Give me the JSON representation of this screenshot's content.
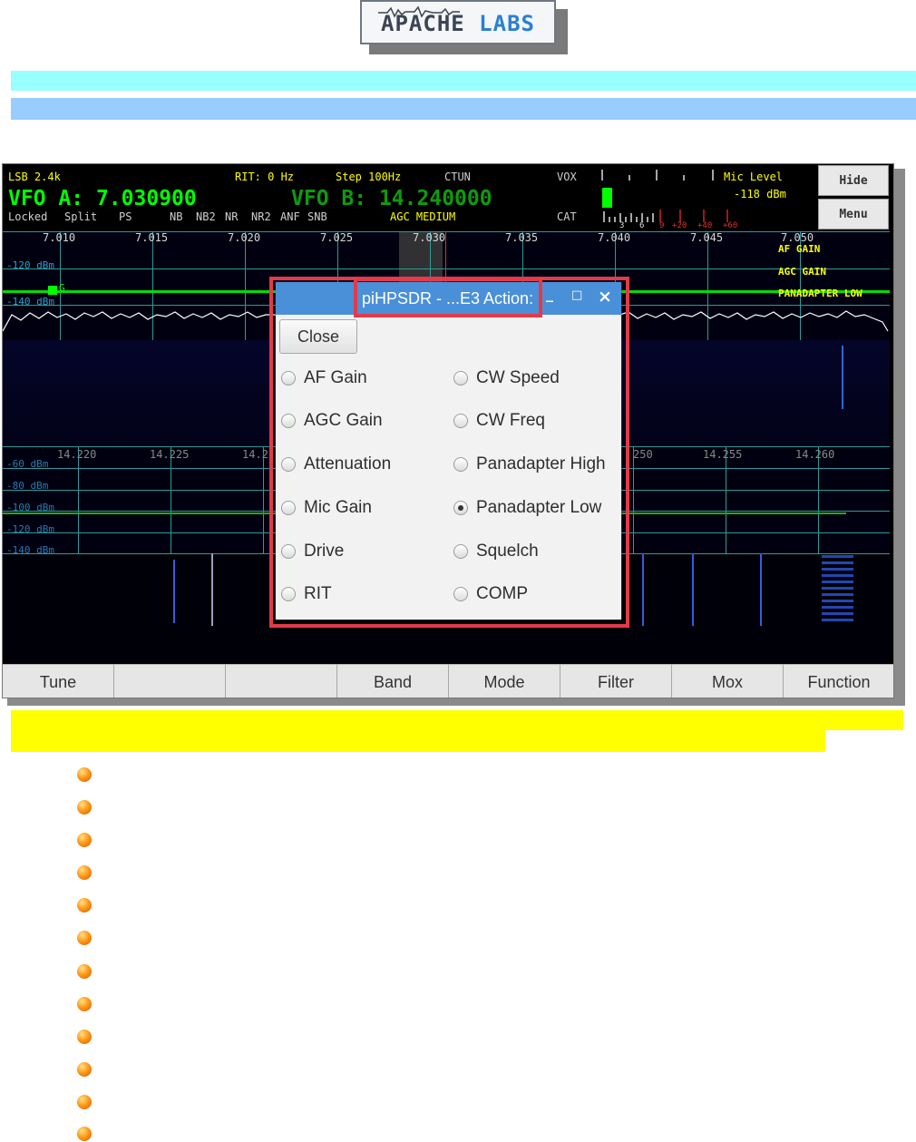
{
  "logo": {
    "text_a": "APACHE",
    "text_b": "LABS"
  },
  "header": {
    "mode": "LSB 2.4k",
    "rit": "RIT: 0 Hz",
    "step": "Step 100Hz",
    "ctun": "CTUN",
    "vox": "VOX",
    "cat": "CAT",
    "mic_level_label": "Mic Level",
    "mic_level_value": "-118 dBm",
    "vfo_a_label": "VFO A:",
    "vfo_a_freq": "7.030900",
    "vfo_b_label": "VFO B:",
    "vfo_b_freq": "14.240000",
    "status_locked": "Locked",
    "status_split": "Split",
    "status_ps": "PS",
    "status_nb": "NB",
    "status_nb2": "NB2",
    "status_nr": "NR",
    "status_nr2": "NR2",
    "status_anf": "ANF",
    "status_snb": "SNB",
    "agc": "AGC MEDIUM",
    "meter_scale": [
      "3",
      "6",
      "9",
      "+20",
      "+40",
      "+60"
    ],
    "hide_label": "Hide",
    "menu_label": "Menu"
  },
  "panadapter_a": {
    "freq_labels": [
      "7.010",
      "7.015",
      "7.020",
      "7.025",
      "7.030",
      "7.035",
      "7.040",
      "7.045",
      "7.050"
    ],
    "db_labels": [
      "-120 dBm",
      "-140 dBm"
    ],
    "marker": "G",
    "overlay": [
      "AF GAIN",
      "AGC GAIN",
      "PANADAPTER LOW"
    ]
  },
  "panadapter_b": {
    "freq_labels": [
      "14.220",
      "14.225",
      "14.2",
      "250",
      "14.255",
      "14.260"
    ],
    "db_labels": [
      "-60 dBm",
      "-80 dBm",
      "-100 dBm",
      "-120 dBm",
      "-140 dBm"
    ]
  },
  "bottom_bar": [
    "Tune",
    "",
    "",
    "Band",
    "Mode",
    "Filter",
    "Mox",
    "Function"
  ],
  "dialog": {
    "title": "piHPSDR - ...E3 Action:",
    "minimize": "_",
    "maximize": "□",
    "close": "×",
    "close_button": "Close",
    "options_left": [
      "AF Gain",
      "AGC Gain",
      "Attenuation",
      "Mic Gain",
      "Drive",
      "RIT"
    ],
    "options_right": [
      "CW Speed",
      "CW Freq",
      "Panadapter High",
      "Panadapter Low",
      "Squelch",
      "COMP"
    ],
    "selected": "Panadapter Low"
  },
  "colors": {
    "accent_red": "#e43a48",
    "title_blue": "#4a90d9",
    "band_cyan": "#99ffff",
    "band_blue": "#99ccff",
    "band_yellow": "#ffff00"
  }
}
